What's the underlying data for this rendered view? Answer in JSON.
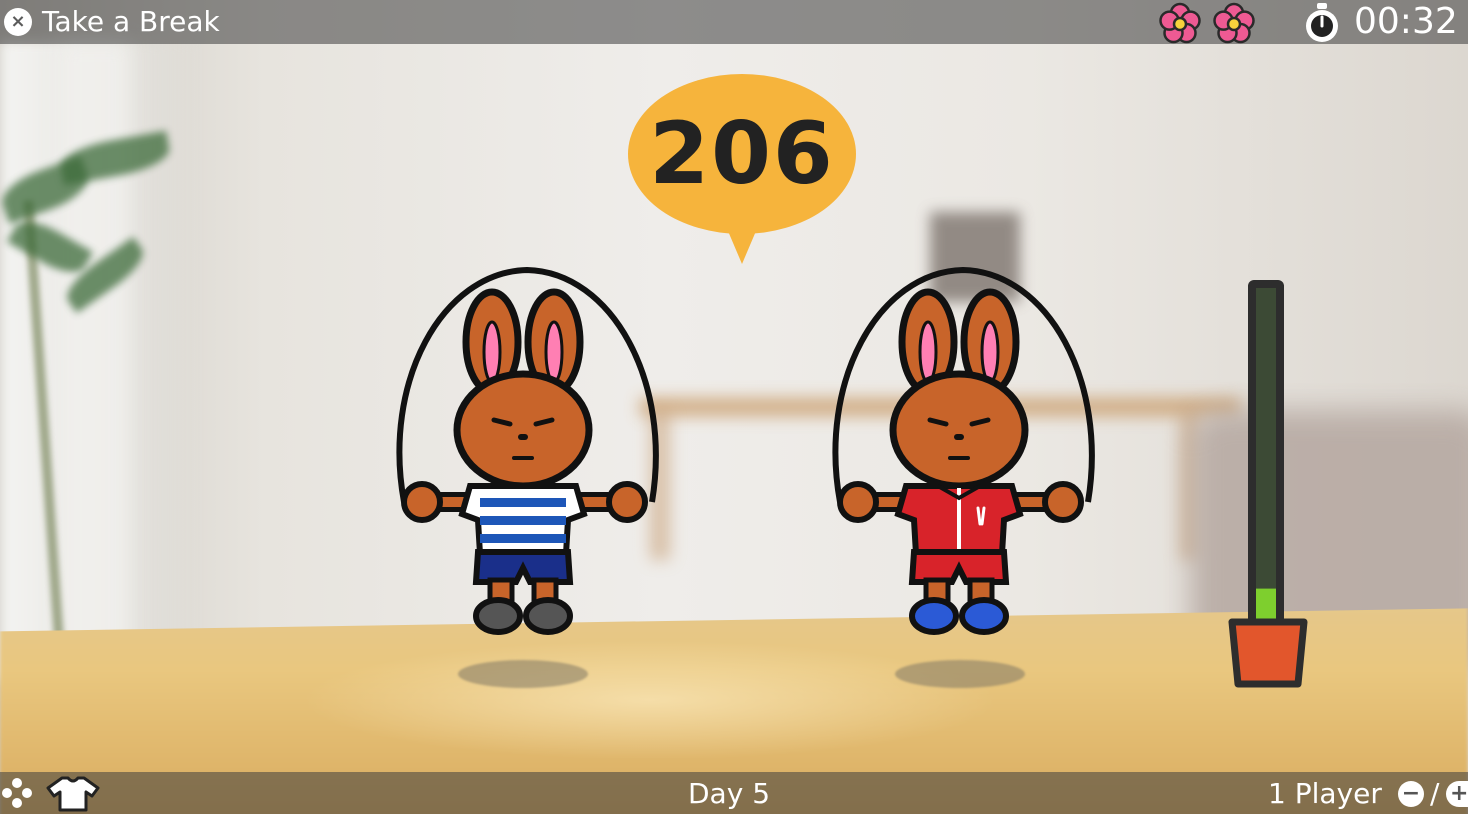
{
  "header": {
    "close_button_glyph": "×",
    "title": "Take a Break",
    "flowers": [
      "flower-icon",
      "flower-icon"
    ],
    "timer": "00:32"
  },
  "game": {
    "jump_count": "206",
    "players": [
      {
        "outfit": "blue-white-striped-shirt",
        "shorts": "navy"
      },
      {
        "outfit": "red-tracksuit",
        "shorts": "red"
      }
    ],
    "power_meter_level": 0.1
  },
  "footer": {
    "day": "Day 5",
    "player_mode": "1 Player",
    "minus_glyph": "−",
    "divider": "/",
    "plus_glyph": "+"
  },
  "colors": {
    "bubble": "#f6b43c",
    "fur": "#c8642a",
    "meter_green": "#7ecf2e",
    "meter_dark": "#3c4a35",
    "meter_base": "#e2562c",
    "flower": "#ee5a93"
  }
}
